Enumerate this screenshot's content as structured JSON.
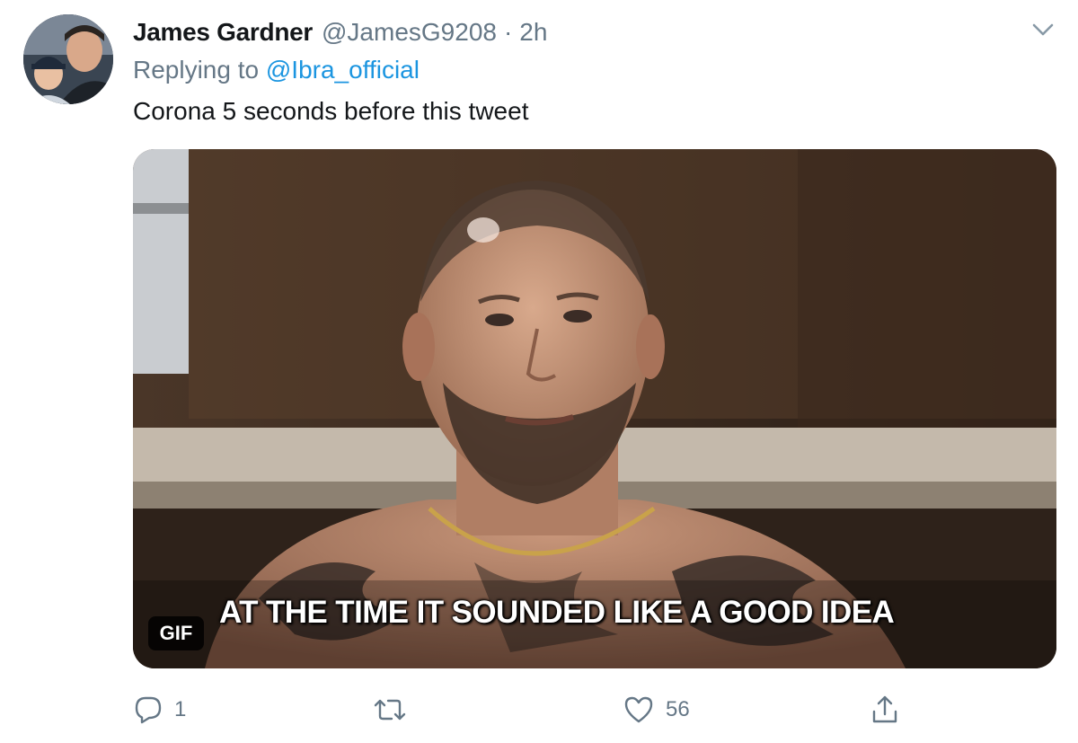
{
  "tweet": {
    "author_name": "James Gardner",
    "handle": "@JamesG9208",
    "separator": "·",
    "time": "2h",
    "replying_prefix": "Replying to",
    "replying_to": "@Ibra_official",
    "text": "Corona 5 seconds before this tweet"
  },
  "media": {
    "badge": "GIF",
    "subtitle": "AT THE TIME IT SOUNDED LIKE A GOOD IDEA"
  },
  "actions": {
    "reply_count": "1",
    "retweet_count": "",
    "like_count": "56"
  },
  "icons": {
    "menu": "chevron-down-icon",
    "reply": "comment-icon",
    "retweet": "retweet-icon",
    "like": "heart-icon",
    "share": "share-icon"
  },
  "colors": {
    "text_primary": "#14171a",
    "text_secondary": "#657786",
    "link": "#1b95e0"
  }
}
